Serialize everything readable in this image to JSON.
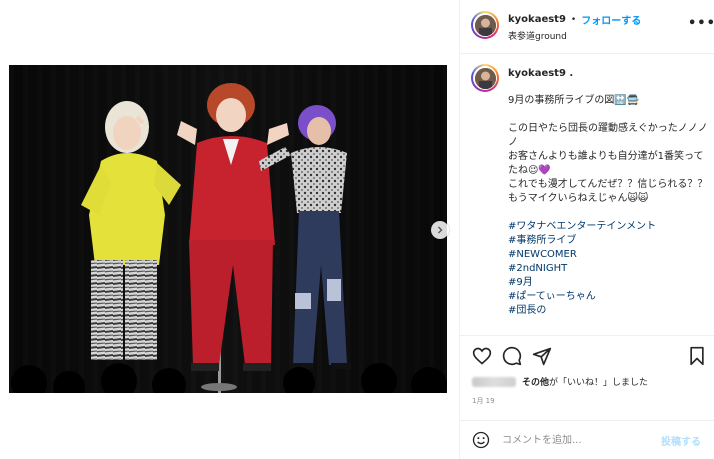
{
  "header": {
    "username": "kyokaest9",
    "separator": "•",
    "follow_label": "フォローする",
    "location": "表参道ground",
    "more_icon": "more-horizontal-icon"
  },
  "caption": {
    "username": "kyokaest9",
    "lines": [
      "9月の事務所ライブの図🔛🚍",
      "",
      "この日やたら団長の躍動感えぐかったノノノノ",
      "お客さんよりも誰よりも自分達が1番笑ってたね😉💜",
      "これでも漫才してんだぜ？？信じられる？？",
      "もうマイクいらねえじゃん🙀🙀"
    ],
    "hashtags": [
      "#ワタナベエンターテインメント",
      "#事務所ライブ",
      "#NEWCOMER",
      "#2ndNIGHT",
      "#9月",
      "#ぱーてぃーちゃん",
      "#団長の"
    ]
  },
  "actions": {
    "like_icon": "heart-icon",
    "comment_icon": "comment-icon",
    "share_icon": "send-icon",
    "save_icon": "bookmark-icon"
  },
  "likes": {
    "text_bold": "その他",
    "text_rest": "が「いいね！」しました"
  },
  "timestamp": "1月 19",
  "comment_box": {
    "placeholder": "コメントを追加...",
    "post_label": "投稿する",
    "emoji_icon": "smile-emoji-icon"
  },
  "colors": {
    "accent": "#0095f6",
    "hashtag": "#00376b",
    "post_disabled": "#b2dffc",
    "muted": "#8e8e8e"
  }
}
